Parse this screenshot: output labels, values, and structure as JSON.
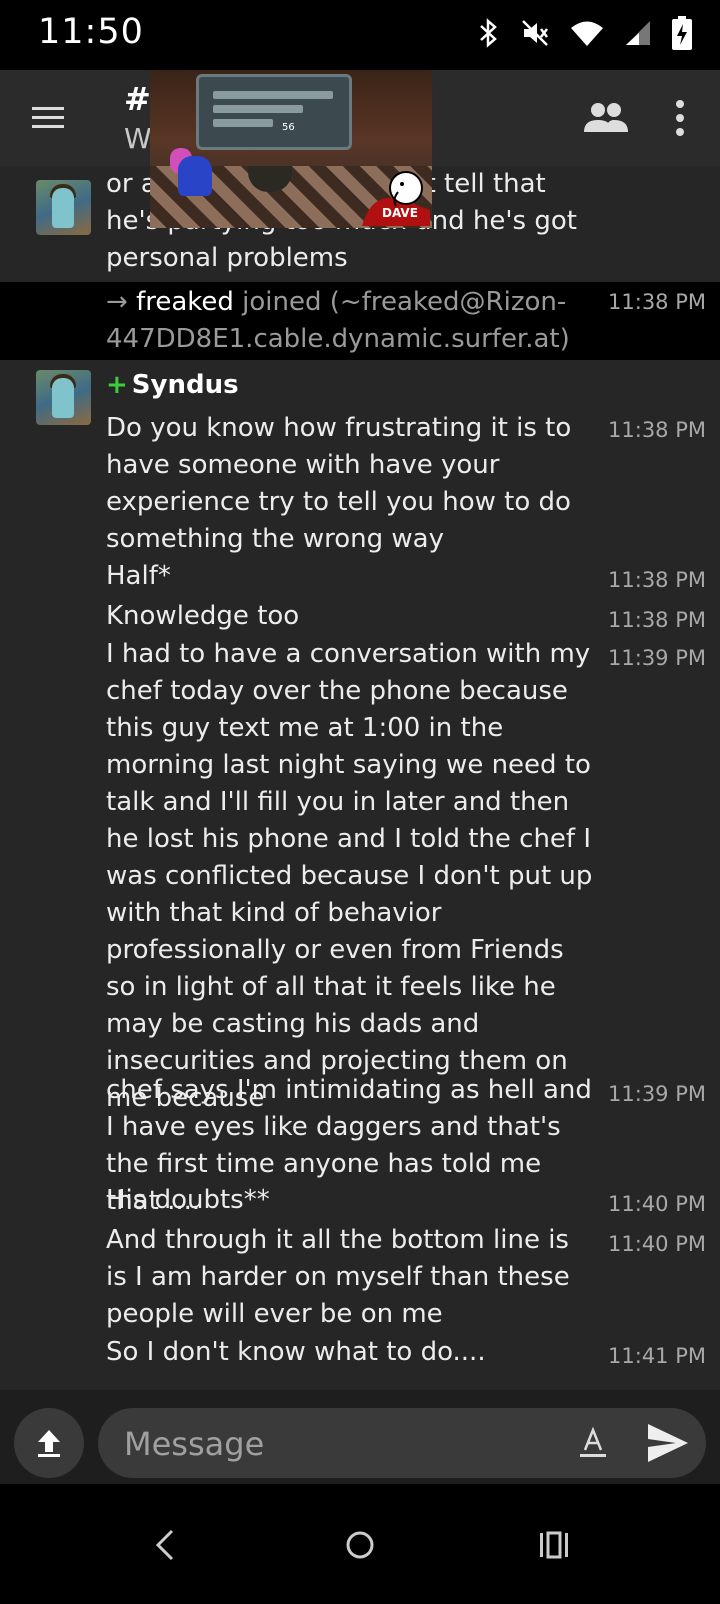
{
  "status_bar": {
    "time": "11:50",
    "icons": [
      "bluetooth-icon",
      "mute-icon",
      "wifi-icon",
      "signal-icon",
      "battery-charging-icon"
    ]
  },
  "app_bar": {
    "channel_name": "#",
    "topic": "W                                go to pla..."
  },
  "video_overlay": {
    "label": "DAVE",
    "score": "56"
  },
  "messages": {
    "partial_top": {
      "text": "or a                               ce guy and I can just tell that he's partying too much and he's got personal problems"
    },
    "join": {
      "arrow": "→",
      "nick": "freaked",
      "text": " joined (~freaked@Rizon-447DD8E1.cable.dynamic.surfer.at)",
      "time": "11:38 PM"
    },
    "group": {
      "op_symbol": "+",
      "nick": "Syndus",
      "items": [
        {
          "text": "Do you know how frustrating it is to have someone with have your experience try to tell you how to do something the wrong way",
          "time": "11:38 PM"
        },
        {
          "text": "Half*",
          "time": "11:38 PM"
        },
        {
          "text": "Knowledge too",
          "time": "11:38 PM"
        },
        {
          "text": "I had to have a conversation with my chef today over the phone because this guy text me at 1:00 in the morning last night saying we need to talk and I'll fill you in later and then he lost his phone and I told the chef I was conflicted because I don't put up with that kind of behavior professionally or even from Friends so in light of all that it feels like he may be casting his dads and insecurities and projecting them on me because",
          "time": "11:39 PM"
        },
        {
          "text": "chef says I'm intimidating as hell and I have eyes like daggers and that's the first time anyone has told me that ....",
          "time": "11:39 PM"
        },
        {
          "text": "His doubts**",
          "time": "11:40 PM"
        },
        {
          "text": "And through it all the bottom line is is I am harder on myself than these people will ever be on me",
          "time": "11:40 PM"
        },
        {
          "text": "So I don't know what to do....",
          "time": "11:41 PM"
        }
      ]
    }
  },
  "composer": {
    "placeholder": "Message",
    "value": ""
  },
  "colors": {
    "op_green": "#3dcc3d",
    "background": "#262626",
    "appbar": "#2b2b2b"
  }
}
